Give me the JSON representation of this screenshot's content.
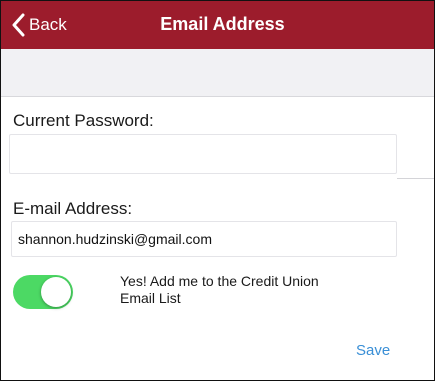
{
  "navbar": {
    "back_label": "Back",
    "title": "Email Address",
    "background_color": "#9c1c2c",
    "back_icon": "chevron-left-icon"
  },
  "form": {
    "current_password": {
      "label": "Current Password:",
      "value": "",
      "placeholder": ""
    },
    "email": {
      "label": "E-mail Address:",
      "value": "shannon.hudzinski@gmail.com",
      "placeholder": ""
    },
    "email_list_toggle": {
      "label": "Yes! Add me to the Credit Union Email List",
      "on": true,
      "on_color": "#4cd964"
    },
    "save_label": "Save",
    "save_color": "#3a8fd6"
  }
}
